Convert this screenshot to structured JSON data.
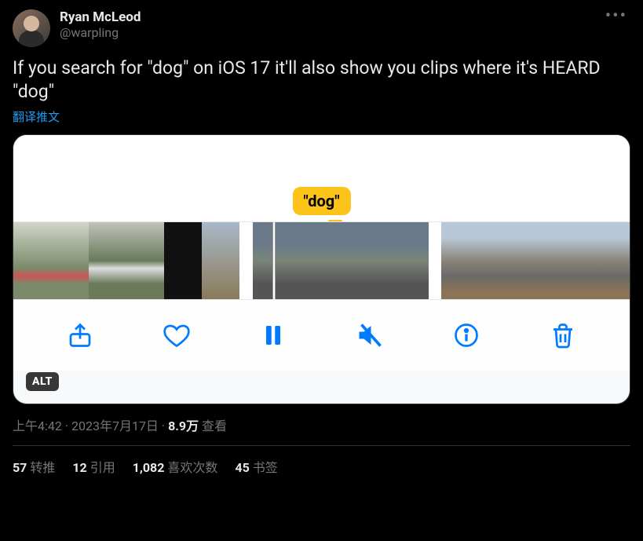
{
  "author": {
    "display_name": "Ryan McLeod",
    "handle": "@warpling"
  },
  "tweet": {
    "text": "If you search for \"dog\" on iOS 17 it'll also show you clips where it's HEARD \"dog\"",
    "translate_label": "翻译推文",
    "search_tag": "\"dog\"",
    "alt_label": "ALT"
  },
  "meta": {
    "time": "上午4:42",
    "sep": " · ",
    "date": "2023年7月17日",
    "views_count": "8.9万",
    "views_label": " 查看"
  },
  "stats": {
    "retweets": {
      "n": "57",
      "label": "转推"
    },
    "quotes": {
      "n": "12",
      "label": "引用"
    },
    "likes": {
      "n": "1,082",
      "label": "喜欢次数"
    },
    "bookmarks": {
      "n": "45",
      "label": "书签"
    }
  }
}
